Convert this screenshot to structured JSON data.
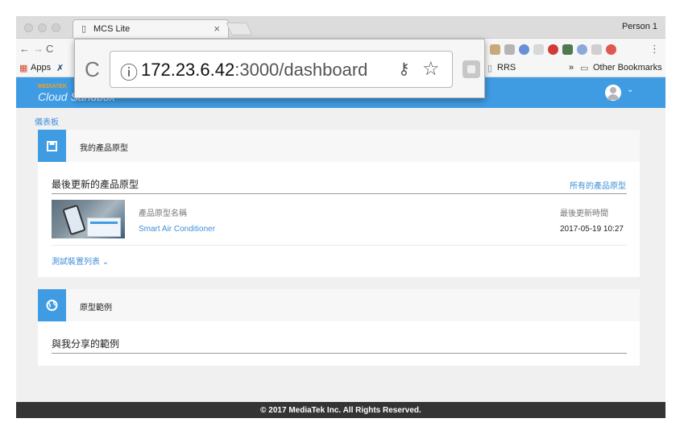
{
  "browser": {
    "tab_title": "MCS Lite",
    "profile": "Person 1",
    "url_host": "172.23.6.42",
    "url_rest": ":3000/dashboard",
    "bookmarks": {
      "apps": "Apps",
      "rrs": "RRS",
      "overflow": "»",
      "other": "Other Bookmarks"
    }
  },
  "app": {
    "brand_small": "MEDIATEK",
    "brand_big": "Cloud Sandbox"
  },
  "breadcrumb": "儀表板",
  "prototypes_card": {
    "title": "我的產品原型",
    "section_title": "最後更新的產品原型",
    "all_link": "所有的產品原型",
    "col_name": "產品原型名稱",
    "col_updated": "最後更新時間",
    "rows": [
      {
        "name": "Smart Air Conditioner",
        "updated": "2017-05-19 10:27"
      }
    ],
    "device_list": "測試裝置列表"
  },
  "examples_card": {
    "title": "原型範例",
    "section_title": "與我分享的範例"
  },
  "footer": "© 2017 MediaTek Inc. All Rights Reserved.",
  "colors": {
    "accent": "#3f9ce3",
    "link": "#3f8fd8",
    "footer_bg": "#343434"
  }
}
